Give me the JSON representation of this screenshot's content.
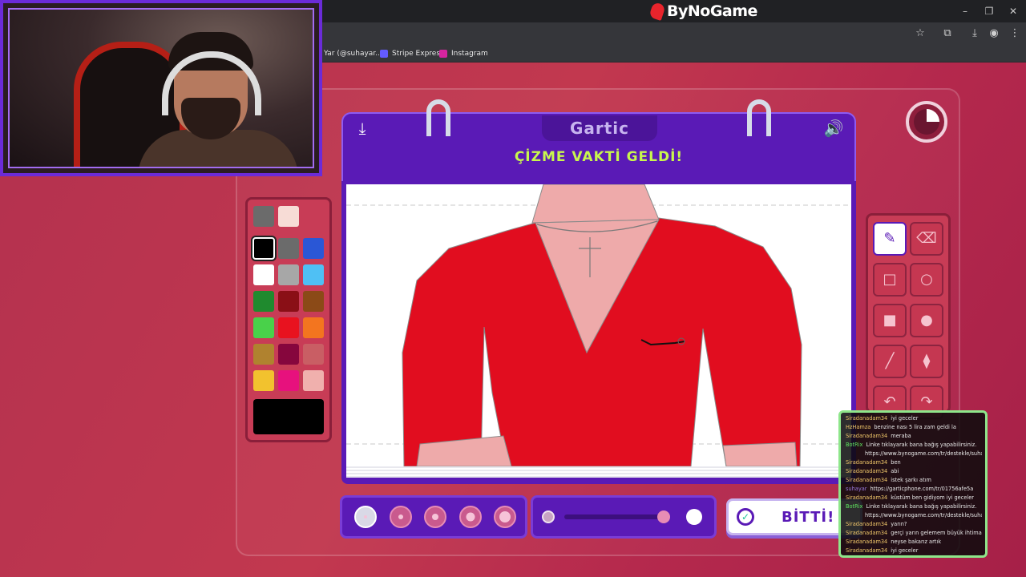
{
  "browser": {
    "brand": "ByNoGame",
    "bookmarks": [
      {
        "label": "Yar (@suhayar....",
        "color": "#3b5998"
      },
      {
        "label": "Stripe Express",
        "color": "#635bff"
      },
      {
        "label": "Instagram",
        "color": "#d6249f"
      }
    ]
  },
  "game": {
    "logo": "Gartic",
    "title": "ÇİZME VAKTİ GELDİ!",
    "done_label": "BİTTİ!",
    "colors": [
      "#6b6b6b",
      "#f7dcd6",
      "#000000",
      "#6b6b6b",
      "#2a57d6",
      "#ffffff",
      "#a7a7a7",
      "#4fc0f4",
      "#1f8a2e",
      "#8a0f16",
      "#8b4a17",
      "#49d14a",
      "#e8121f",
      "#f3751f",
      "#b0822f",
      "#86063d",
      "#c95e64",
      "#f2c22e",
      "#e7117d",
      "#f0b0ad"
    ],
    "selected_color": "#000000",
    "tools": [
      {
        "name": "pencil-tool",
        "glyph": "✎",
        "active": true
      },
      {
        "name": "eraser-tool",
        "glyph": "⌫",
        "active": false
      },
      {
        "name": "rectangle-outline-tool",
        "glyph": "□",
        "active": false
      },
      {
        "name": "ellipse-outline-tool",
        "glyph": "○",
        "active": false
      },
      {
        "name": "rectangle-fill-tool",
        "glyph": "■",
        "active": false
      },
      {
        "name": "ellipse-fill-tool",
        "glyph": "●",
        "active": false
      },
      {
        "name": "line-tool",
        "glyph": "╱",
        "active": false
      },
      {
        "name": "fill-bucket-tool",
        "glyph": "⧫",
        "active": false
      },
      {
        "name": "undo-tool",
        "glyph": "↶",
        "active": false
      },
      {
        "name": "redo-tool",
        "glyph": "↷",
        "active": false
      }
    ],
    "brush_sizes": [
      4,
      6,
      8,
      11,
      14
    ],
    "selected_size": 0,
    "timer_remaining_fraction": 0.25,
    "opacity_fraction": 0.95
  },
  "chat": [
    {
      "user": "Siradanadam34",
      "text": "iyi geceler",
      "color": "#f0c76a"
    },
    {
      "user": "HzHamza",
      "text": "benzine nası 5 lira zam geldi la",
      "color": "#f0c76a"
    },
    {
      "user": "Siradanadam34",
      "text": "meraba",
      "color": "#f0c76a"
    },
    {
      "user": "BotRix",
      "text": "Linke tıklayarak bana bağış yapabilirsiniz.",
      "color": "#5fe35f"
    },
    {
      "user": "",
      "text": "https://www.bynogame.com/tr/destekle/suhayar",
      "color": "#5fe35f"
    },
    {
      "user": "Siradanadam34",
      "text": "ben",
      "color": "#f0c76a"
    },
    {
      "user": "Siradanadam34",
      "text": "abi",
      "color": "#f0c76a"
    },
    {
      "user": "Siradanadam34",
      "text": "istek şarkı atım",
      "color": "#f0c76a"
    },
    {
      "user": "suhayar",
      "text": "https://garticphone.com/tr/01756afe5a",
      "color": "#9b7ae0"
    },
    {
      "user": "Siradanadam34",
      "text": "küstüm ben gidiyom iyi geceler",
      "color": "#f0c76a"
    },
    {
      "user": "BotRix",
      "text": "Linke tıklayarak bana bağış yapabilirsiniz.",
      "color": "#5fe35f"
    },
    {
      "user": "",
      "text": "https://www.bynogame.com/tr/destekle/suhayar",
      "color": "#5fe35f"
    },
    {
      "user": "Siradanadam34",
      "text": "yarın?",
      "color": "#f0c76a"
    },
    {
      "user": "Siradanadam34",
      "text": "gerçi yarın gelemem büyük ihtimal",
      "color": "#f0c76a"
    },
    {
      "user": "Siradanadam34",
      "text": "neyse bakarız artık",
      "color": "#f0c76a"
    },
    {
      "user": "Siradanadam34",
      "text": "iyi geceler",
      "color": "#f0c76a"
    }
  ]
}
